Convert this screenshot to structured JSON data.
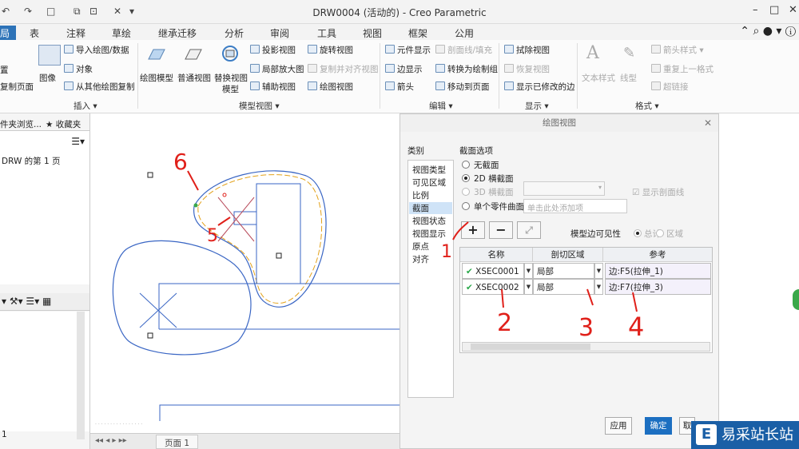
{
  "window": {
    "title": "DRW0004 (活动的) - Creo Parametric",
    "min": "–",
    "max": "□",
    "close": "✕"
  },
  "quick_access": {
    "undo": "↶",
    "redo": "↷",
    "regen": "□",
    "close_win": "✕",
    "more": "▾"
  },
  "tabs": [
    {
      "label": "局",
      "active": true
    },
    {
      "label": "表"
    },
    {
      "label": "注释"
    },
    {
      "label": "草绘"
    },
    {
      "label": "继承迁移"
    },
    {
      "label": "分析"
    },
    {
      "label": "审阅"
    },
    {
      "label": "工具"
    },
    {
      "label": "视图"
    },
    {
      "label": "框架"
    },
    {
      "label": "公用"
    }
  ],
  "right_icons": "⌃ ⌕ ● ▾ ⓘ",
  "ribbon": {
    "insert": {
      "left_cut_1": "置",
      "left_cut_2": "复制页面",
      "image": "图像",
      "import": "导入绘图/数据",
      "object": "对象",
      "copy_from": "从其他绘图复制",
      "group": "插入"
    },
    "model_views": {
      "general": "绘图模型",
      "normal": "普通视图",
      "replace": "替换视图",
      "replace2": "模型",
      "projection": "投影视图",
      "detailed": "局部放大图",
      "auxiliary": "辅助视图",
      "revolved": "旋转视图",
      "copy_align": "复制并对齐视图",
      "drawing_view": "绘图视图",
      "group": "模型视图"
    },
    "edit": {
      "element_display": "元件显示",
      "edge_display": "边显示",
      "arrow": "箭头",
      "xhatch": "剖面线/填充",
      "convert": "转换为绘制组",
      "move_page": "移动到页面",
      "group": "编辑"
    },
    "display": {
      "erase": "拭除视图",
      "resume": "恢复视图",
      "show_modified": "显示已修改的边",
      "group": "显示"
    },
    "format": {
      "text_style": "文本样式",
      "line_style": "线型",
      "arrow_style": "箭头样式",
      "repeat": "重复上一格式",
      "hyperlink": "超链接",
      "group": "格式"
    }
  },
  "left_panel": {
    "tab1": "件夹浏览...",
    "tab2": "收藏夹",
    "page_item": "DRW 的第 1 页",
    "bottom_num": "1"
  },
  "drawing": {
    "page_tab": "页面 1",
    "status_text": "",
    "annotations": [
      "6",
      "5",
      "1",
      "2",
      "3",
      "4"
    ]
  },
  "dialog": {
    "title": "绘图视图",
    "categories_label": "类别",
    "categories": [
      {
        "label": "视图类型"
      },
      {
        "label": "可见区域"
      },
      {
        "label": "比例"
      },
      {
        "label": "截面",
        "selected": true
      },
      {
        "label": "视图状态"
      },
      {
        "label": "视图显示"
      },
      {
        "label": "原点"
      },
      {
        "label": "对齐"
      }
    ],
    "section_options": "截面选项",
    "none": "无截面",
    "xsec_2d": "2D 横截面",
    "xsec_3d": "3D 横截面",
    "show_hatch": "显示剖面线",
    "single_surface": "单个零件曲面",
    "single_placeholder": "单击此处添加项",
    "add": "+",
    "remove": "−",
    "model_edge_vis": "模型边可见性",
    "total": "总计",
    "area": "区域",
    "columns": [
      "名称",
      "剖切区域",
      "参考"
    ],
    "rows": [
      {
        "name": "XSEC0001",
        "area": "局部",
        "ref": "边:F5(拉伸_1)"
      },
      {
        "name": "XSEC0002",
        "area": "局部",
        "ref": "边:F7(拉伸_3)"
      }
    ],
    "apply": "应用",
    "ok": "确定",
    "cancel": "取"
  },
  "watermark": {
    "logo": "E",
    "text": "易采站长站"
  },
  "colors": {
    "accent": "#2d73b8",
    "annotation_red": "#e0201a",
    "geometry_blue": "#3a66c4",
    "preview_orange": "#e3a21a"
  }
}
